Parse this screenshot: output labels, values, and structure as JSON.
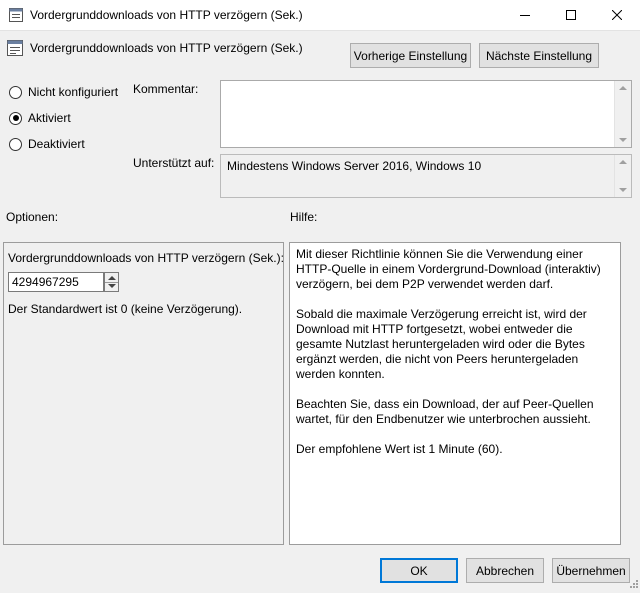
{
  "window": {
    "title": "Vordergrunddownloads von HTTP verzögern (Sek.)"
  },
  "header": {
    "title": "Vordergrunddownloads von HTTP verzögern (Sek.)",
    "prev_button": "Vorherige Einstellung",
    "next_button": "Nächste Einstellung"
  },
  "state": {
    "options": [
      {
        "label": "Nicht konfiguriert",
        "checked": false
      },
      {
        "label": "Aktiviert",
        "checked": true
      },
      {
        "label": "Deaktiviert",
        "checked": false
      }
    ]
  },
  "comment": {
    "label": "Kommentar:",
    "value": ""
  },
  "supported": {
    "label": "Unterstützt auf:",
    "value": "Mindestens Windows Server 2016, Windows 10"
  },
  "options_section": {
    "heading": "Optionen:",
    "field_label": "Vordergrunddownloads von HTTP verzögern (Sek.):",
    "field_value": "4294967295",
    "default_note": "Der Standardwert ist 0 (keine Verzögerung)."
  },
  "help_section": {
    "heading": "Hilfe:",
    "paragraphs": [
      "Mit dieser Richtlinie können Sie die Verwendung einer HTTP-Quelle in einem Vordergrund-Download (interaktiv) verzögern, bei dem P2P verwendet werden darf.",
      "Sobald die maximale Verzögerung erreicht ist, wird der Download mit HTTP fortgesetzt, wobei entweder die gesamte Nutzlast heruntergeladen wird oder die Bytes ergänzt werden, die nicht von Peers heruntergeladen werden konnten.",
      "Beachten Sie, dass ein Download, der auf Peer-Quellen wartet, für den Endbenutzer wie unterbrochen aussieht.",
      "Der empfohlene Wert ist 1 Minute (60)."
    ]
  },
  "footer": {
    "ok": "OK",
    "cancel": "Abbrechen",
    "apply": "Übernehmen"
  },
  "icons": [
    "policy-icon",
    "minimize-icon",
    "maximize-icon",
    "close-icon",
    "resize-grip-icon"
  ]
}
